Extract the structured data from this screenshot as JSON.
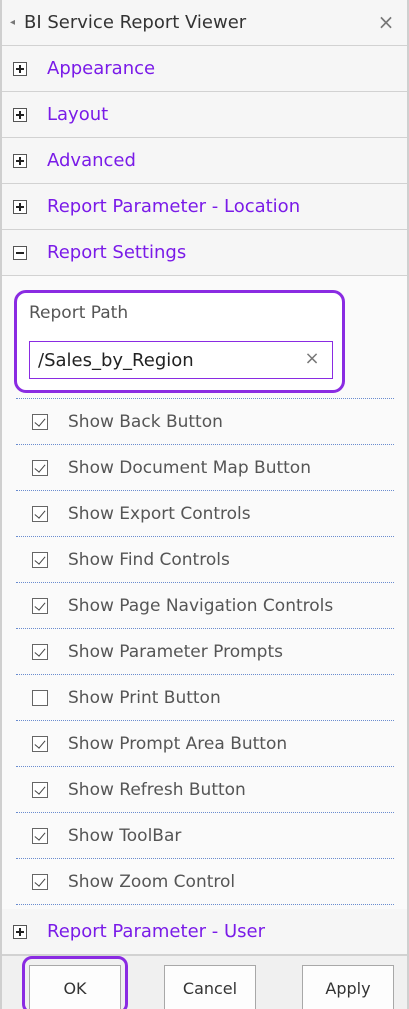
{
  "window": {
    "title": "BI Service Report Viewer",
    "collapse_glyph": "◂",
    "close_glyph": "×"
  },
  "sections": {
    "appearance": "Appearance",
    "layout": "Layout",
    "advanced": "Advanced",
    "report_parameter_location": "Report Parameter - Location",
    "report_settings": "Report Settings",
    "report_parameter_user": "Report Parameter - User"
  },
  "report_settings": {
    "report_path_label": "Report Path",
    "report_path_value": "/Sales_by_Region",
    "clear_glyph": "×",
    "options": [
      {
        "label": "Show Back Button",
        "checked": true
      },
      {
        "label": "Show Document Map Button",
        "checked": true
      },
      {
        "label": "Show Export Controls",
        "checked": true
      },
      {
        "label": "Show Find Controls",
        "checked": true
      },
      {
        "label": "Show Page Navigation Controls",
        "checked": true
      },
      {
        "label": "Show Parameter Prompts",
        "checked": true
      },
      {
        "label": "Show Print Button",
        "checked": false
      },
      {
        "label": "Show Prompt Area Button",
        "checked": true
      },
      {
        "label": "Show Refresh Button",
        "checked": true
      },
      {
        "label": "Show ToolBar",
        "checked": true
      },
      {
        "label": "Show Zoom Control",
        "checked": true
      }
    ]
  },
  "buttons": {
    "ok": "OK",
    "cancel": "Cancel",
    "apply": "Apply"
  },
  "colors": {
    "accent": "#8a2be2",
    "link": "#7a1be8"
  }
}
